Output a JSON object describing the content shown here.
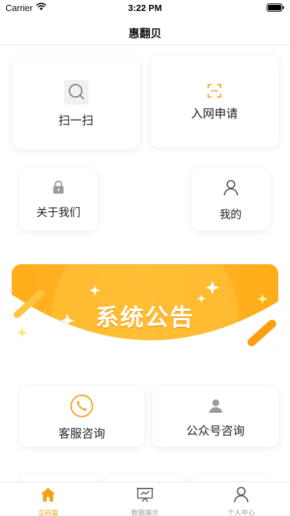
{
  "status_bar": {
    "carrier": "Carrier",
    "time": "3:22 PM"
  },
  "nav": {
    "title": "惠翻贝"
  },
  "grid": {
    "scan_label": "扫一扫",
    "apply_label": "入网申请",
    "about_label": "关于我们",
    "mine_label": "我的"
  },
  "banner": {
    "title": "系统公告"
  },
  "contact": {
    "service_label": "客服咨询",
    "wechat_label": "公众号咨询"
  },
  "tabs": [
    {
      "label": "立码富",
      "icon": "home-icon",
      "active": true
    },
    {
      "label": "数据展示",
      "icon": "presentation-icon",
      "active": false
    },
    {
      "label": "个人中心",
      "icon": "user-icon",
      "active": false
    }
  ],
  "colors": {
    "accent": "#f2a21a",
    "banner": "#ffb22a",
    "inactive_tab": "#9b9b9b"
  }
}
